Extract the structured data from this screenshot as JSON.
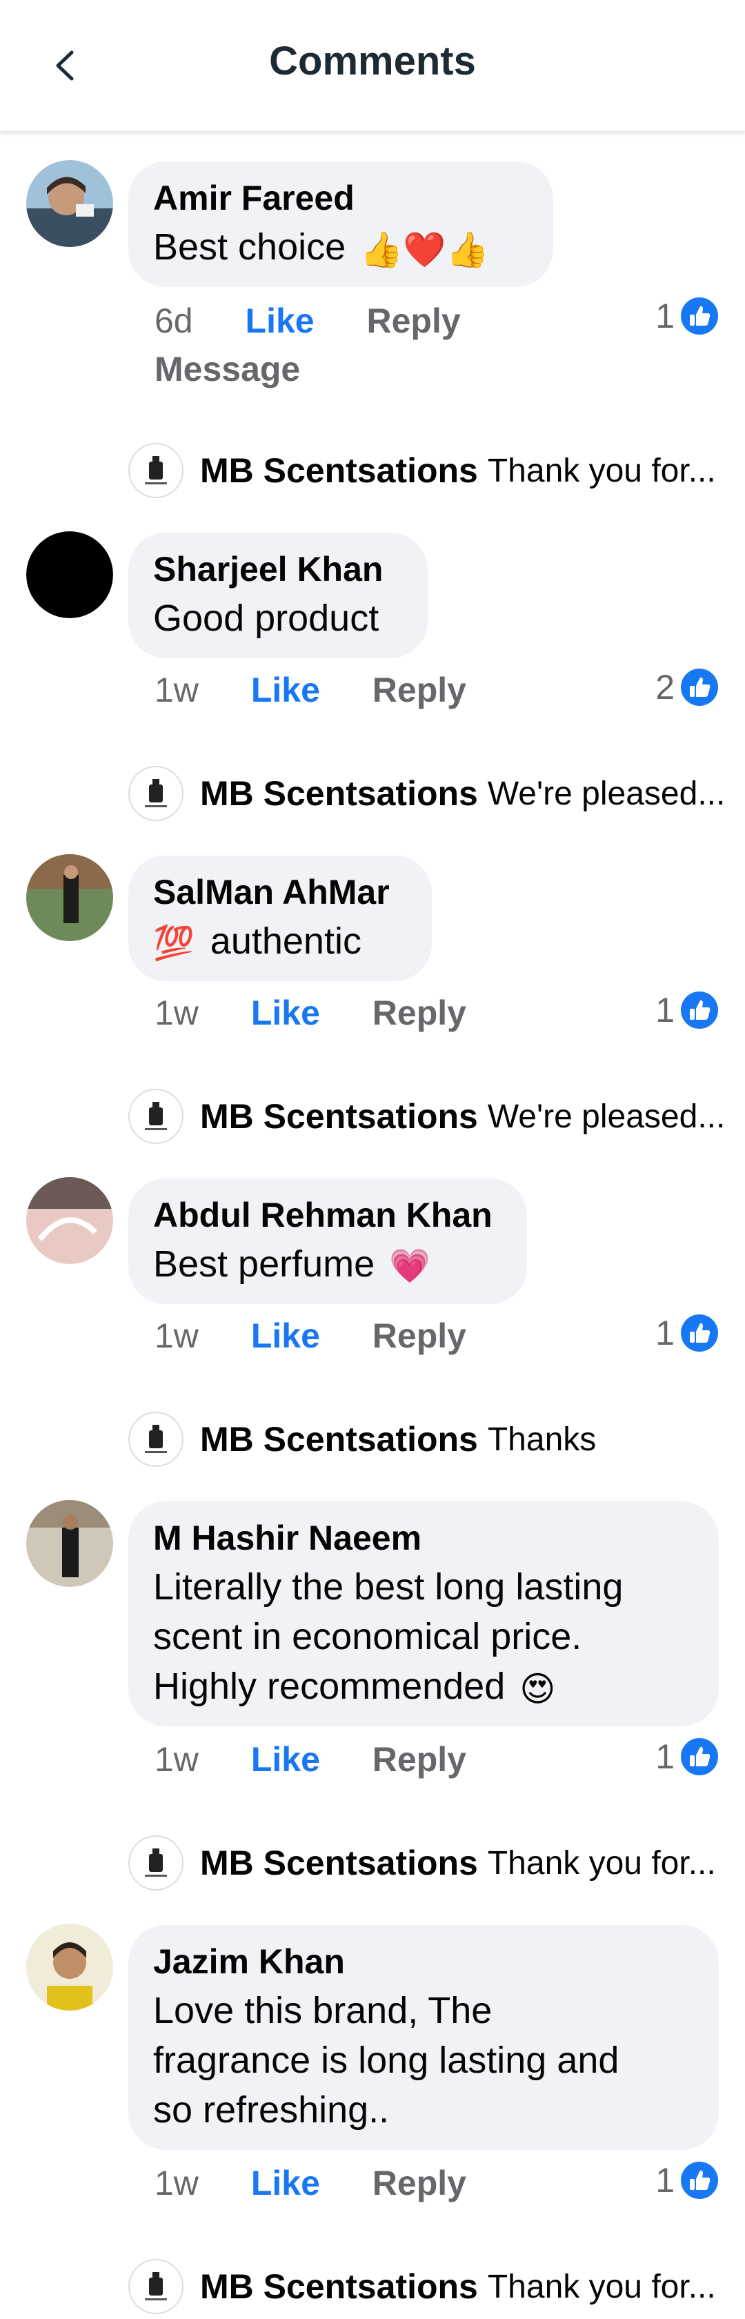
{
  "header": {
    "title": "Comments"
  },
  "comments": [
    {
      "author": "Amir Fareed",
      "text": "Best choice",
      "emoji": "👍❤️👍",
      "time": "6d",
      "like": "Like",
      "reply": "Reply",
      "message": "Message",
      "reactions": "1",
      "page_reply": {
        "name": "MB Scentsations",
        "text": "Thank you for..."
      }
    },
    {
      "author": "Sharjeel Khan",
      "text": "Good product",
      "time": "1w",
      "like": "Like",
      "reply": "Reply",
      "reactions": "2",
      "page_reply": {
        "name": "MB Scentsations",
        "text": "We're pleased..."
      }
    },
    {
      "author": "SalMan AhMar",
      "text": "authentic",
      "emoji": "💯",
      "time": "1w",
      "like": "Like",
      "reply": "Reply",
      "reactions": "1",
      "page_reply": {
        "name": "MB Scentsations",
        "text": "We're pleased..."
      }
    },
    {
      "author": "Abdul Rehman Khan",
      "text": "Best perfume",
      "emoji": "💗",
      "time": "1w",
      "like": "Like",
      "reply": "Reply",
      "reactions": "1",
      "page_reply": {
        "name": "MB Scentsations",
        "text": "Thanks"
      }
    },
    {
      "author": "M Hashir Naeem",
      "lines": [
        "Literally the best long lasting",
        "scent in economical price.",
        "Highly recommended"
      ],
      "emoji": "😍",
      "time": "1w",
      "like": "Like",
      "reply": "Reply",
      "reactions": "1",
      "page_reply": {
        "name": "MB Scentsations",
        "text": "Thank you for..."
      }
    },
    {
      "author": "Jazim Khan",
      "lines": [
        "Love this brand, The",
        "fragrance is long lasting and",
        "so refreshing.."
      ],
      "time": "1w",
      "like": "Like",
      "reply": "Reply",
      "reactions": "1",
      "page_reply": {
        "name": "MB Scentsations",
        "text": "Thank you for..."
      }
    }
  ],
  "colors": {
    "accent": "#1877f2",
    "bubble": "#f0f2f5",
    "muted": "#65676b"
  }
}
